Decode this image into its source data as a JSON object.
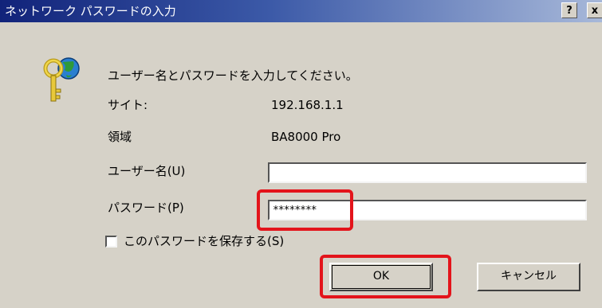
{
  "window": {
    "title": "ネットワーク パスワードの入力",
    "help_label": "?",
    "close_label": "x"
  },
  "message": "ユーザー名とパスワードを入力してください。",
  "site": {
    "label": "サイト:",
    "value": "192.168.1.1"
  },
  "realm": {
    "label": "領域",
    "value": "BA8000 Pro"
  },
  "username": {
    "label": "ユーザー名(U)",
    "value": ""
  },
  "password": {
    "label": "パスワード(P)",
    "value": "********"
  },
  "save_password": {
    "label": "このパスワードを保存する(S)",
    "checked": false
  },
  "buttons": {
    "ok": "OK",
    "cancel": "キャンセル"
  },
  "annotations": {
    "highlight_color": "#e3141b"
  },
  "icons": {
    "dialog_icon": "keys-icon"
  }
}
